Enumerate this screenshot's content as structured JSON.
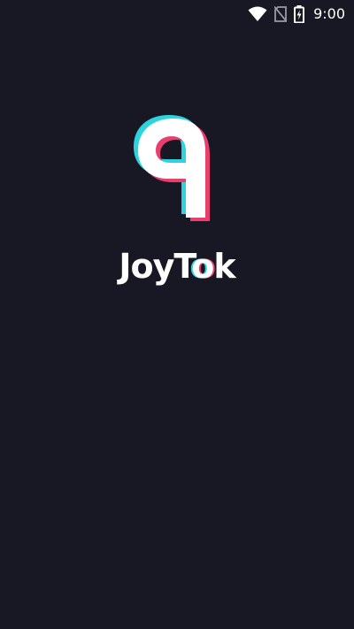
{
  "status_bar": {
    "time": "9:00",
    "icons": [
      "wifi-icon",
      "no-sim-icon",
      "battery-charging-icon"
    ]
  },
  "splash": {
    "app_name_prefix": "JoyT",
    "app_name_accent": "o",
    "app_name_suffix": "k",
    "logo_icon": "joytok-logo-icon",
    "colors": {
      "background": "#181824",
      "accent_cyan": "#2ed3e0",
      "accent_pink": "#ea3f6d",
      "foreground": "#ffffff"
    }
  }
}
